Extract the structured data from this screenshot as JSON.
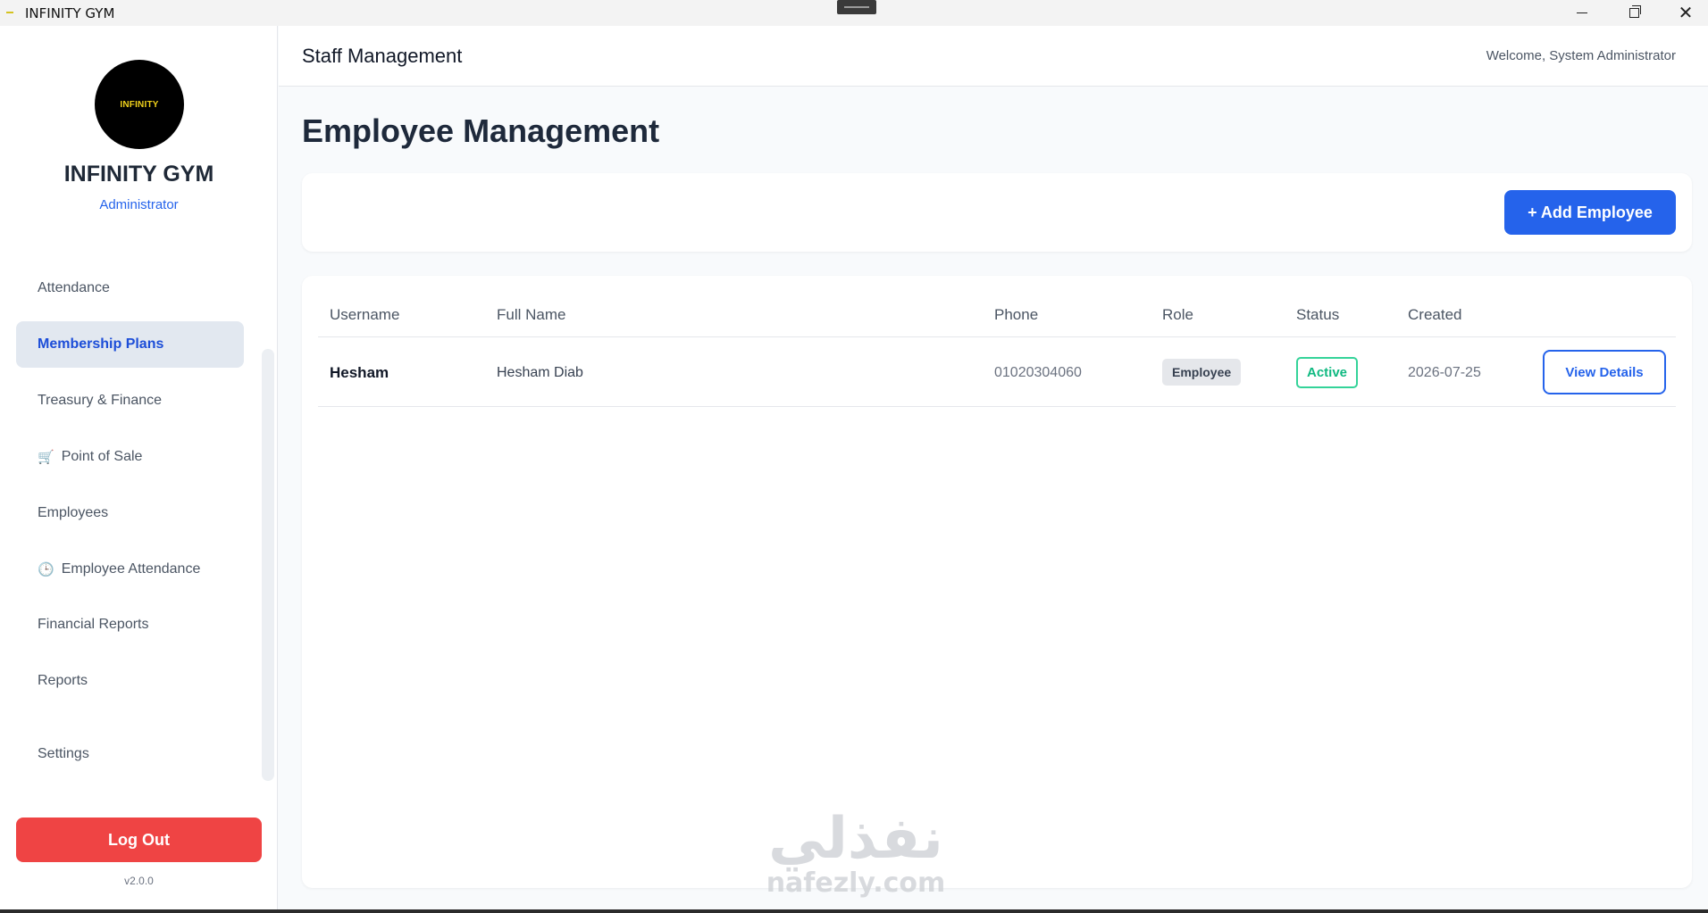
{
  "window": {
    "title": "INFINITY GYM",
    "minimize_icon": "minimize-icon",
    "maximize_icon": "restore-icon",
    "close_icon": "close-icon",
    "close_glyph": "✕"
  },
  "sidebar": {
    "logo_text": "INFINITY",
    "brand_name": "INFINITY GYM",
    "role": "Administrator",
    "items": [
      {
        "label": "Attendance",
        "icon": ""
      },
      {
        "label": "Membership Plans",
        "icon": "",
        "active": true
      },
      {
        "label": "Treasury & Finance",
        "icon": ""
      },
      {
        "label": "Point of Sale",
        "icon": "cart-icon",
        "glyph": "🛒"
      },
      {
        "label": "Employees",
        "icon": ""
      },
      {
        "label": "Employee Attendance",
        "icon": "clock-icon",
        "glyph": "🕒"
      },
      {
        "label": "Financial Reports",
        "icon": ""
      },
      {
        "label": "Reports",
        "icon": ""
      },
      {
        "label": "Settings",
        "icon": ""
      }
    ],
    "logout_label": "Log Out",
    "version": "v2.0.0"
  },
  "header": {
    "title": "Staff Management",
    "welcome": "Welcome, System Administrator"
  },
  "main": {
    "page_title": "Employee Management",
    "add_button_label": "+ Add Employee",
    "table": {
      "columns": [
        "Username",
        "Full Name",
        "Phone",
        "Role",
        "Status",
        "Created"
      ],
      "rows": [
        {
          "username": "Hesham",
          "full_name": "Hesham Diab",
          "phone": "01020304060",
          "role": "Employee",
          "status": "Active",
          "created": "2026-07-25",
          "action_label": "View Details"
        }
      ]
    }
  },
  "watermark": {
    "arabic": "نفذلي",
    "latin": "nafezly.com"
  },
  "colors": {
    "accent": "#2563eb",
    "danger": "#ef4444",
    "success": "#10b981",
    "logo_text": "#f2d21b"
  }
}
